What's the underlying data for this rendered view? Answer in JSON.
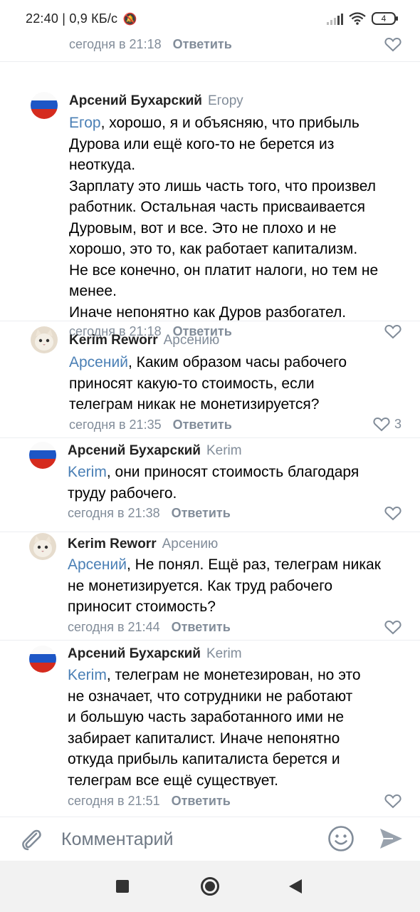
{
  "status_bar": {
    "time": "22:40",
    "speed": "| 0,9 КБ/с",
    "battery": "4"
  },
  "top_meta": {
    "time": "сегодня в 21:18",
    "reply": "Ответить"
  },
  "comments": [
    {
      "author": "Арсений Бухарский",
      "reply_to": "Егору",
      "mention": "Егор",
      "text": ", хорошо, я и объясняю, что прибыль\nДурова или ещё кого-то не берется из\nнеоткуда.\nЗарплату это лишь часть того, что произвел\nработник. Остальная часть присваивается\nДуровым, вот и все. Это не плохо и не\nхорошо, это то, как работает капитализм.\nНе все конечно, он платит налоги, но тем не\nменее.\nИначе непонятно как Дуров разбогател.",
      "time": "сегодня в 21:18",
      "reply": "Ответить",
      "likes": ""
    },
    {
      "author": "Kerim Reworr",
      "reply_to": "Арсению",
      "mention": "Арсений",
      "text": ", Каким образом часы рабочего\nприносят какую-то стоимость, если\nтелеграм никак не монетизируется?",
      "time": "сегодня в 21:35",
      "reply": "Ответить",
      "likes": "3"
    },
    {
      "author": "Арсений Бухарский",
      "reply_to": "Kerim",
      "mention": "Kerim",
      "text": ", они приносят стоимость благодаря\nтруду рабочего.",
      "time": "сегодня в 21:38",
      "reply": "Ответить",
      "likes": ""
    },
    {
      "author": "Kerim Reworr",
      "reply_to": "Арсению",
      "mention": "Арсений",
      "text": ", Не понял. Ещё раз, телеграм никак\nне монетизируется. Как труд рабочего\nприносит стоимость?",
      "time": "сегодня в 21:44",
      "reply": "Ответить",
      "likes": ""
    },
    {
      "author": "Арсений Бухарский",
      "reply_to": "Kerim",
      "mention": "Kerim",
      "text": ", телеграм не монетезирован, но это\nне означает, что сотрудники не работают\nи большую часть заработанного ими не\nзабирает капиталист. Иначе непонятно\nоткуда прибыль капиталиста берется и\nтелеграм все ещё существует.",
      "time": "сегодня в 21:51",
      "reply": "Ответить",
      "likes": ""
    }
  ],
  "input": {
    "placeholder": "Комментарий"
  },
  "colors": {
    "mention": "#4a7fb5",
    "meta": "#818c99",
    "nav_bg": "#f2f2f2"
  }
}
